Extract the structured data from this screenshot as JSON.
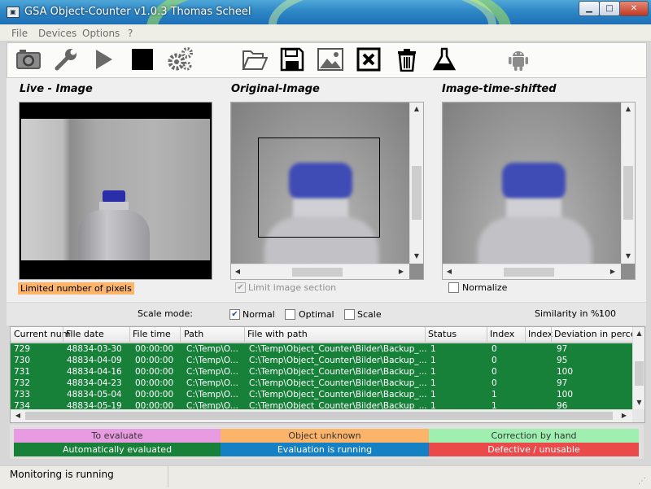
{
  "window": {
    "title": "GSA Object-Counter v1.0.3  Thomas Scheel",
    "app_icon": "camera-icon"
  },
  "menu": [
    "File",
    "Devices",
    "Options",
    "?"
  ],
  "toolbar": {
    "icons": [
      "camera-icon",
      "wrench-icon",
      "play-icon",
      "stop-icon",
      "gears-icon",
      "folder-open-icon",
      "save-icon",
      "image-icon",
      "delete-image-icon",
      "trash-icon",
      "flask-icon",
      "android-icon"
    ]
  },
  "panels": {
    "live_title": "Live - Image",
    "original_title": "Original-Image",
    "shifted_title": "Image-time-shifted",
    "limited_pixels": "Limited number of pixels",
    "limit_section": "Limit image section",
    "normalize": "Normalize"
  },
  "scale": {
    "label": "Scale mode:",
    "options": [
      {
        "label": "Normal",
        "checked": true
      },
      {
        "label": "Optimal",
        "checked": false
      },
      {
        "label": "Scale",
        "checked": false
      }
    ],
    "similarity_label": "Similarity in %:",
    "similarity_value": "100"
  },
  "table": {
    "columns": [
      "Current numl",
      "File date",
      "File time",
      "Path",
      "File with path",
      "Status",
      "Index",
      "Index",
      "Deviation in percent"
    ],
    "rows": [
      [
        "729",
        "48834-03-30",
        "00:00:00",
        "C:\\Temp\\O...",
        "C:\\Temp\\Object_Counter\\Bilder\\Backup_...",
        "1",
        "0",
        "97"
      ],
      [
        "730",
        "48834-04-09",
        "00:00:00",
        "C:\\Temp\\O...",
        "C:\\Temp\\Object_Counter\\Bilder\\Backup_...",
        "1",
        "0",
        "95"
      ],
      [
        "731",
        "48834-04-16",
        "00:00:00",
        "C:\\Temp\\O...",
        "C:\\Temp\\Object_Counter\\Bilder\\Backup_...",
        "1",
        "0",
        "100"
      ],
      [
        "732",
        "48834-04-23",
        "00:00:00",
        "C:\\Temp\\O...",
        "C:\\Temp\\Object_Counter\\Bilder\\Backup_...",
        "1",
        "0",
        "97"
      ],
      [
        "733",
        "48834-05-04",
        "00:00:00",
        "C:\\Temp\\O...",
        "C:\\Temp\\Object_Counter\\Bilder\\Backup_...",
        "1",
        "1",
        "100"
      ],
      [
        "734",
        "48834-05-19",
        "00:00:00",
        "C:\\Temp\\O...",
        "C:\\Temp\\Object_Counter\\Bilder\\Backup_...",
        "1",
        "1",
        "96"
      ]
    ]
  },
  "legend": [
    {
      "label": "To evaluate",
      "color": "#e89be0",
      "text_color": "#333333"
    },
    {
      "label": "Object unknown",
      "color": "#fcb46a",
      "text_color": "#333333"
    },
    {
      "label": "Correction by hand",
      "color": "#9ff0b0",
      "text_color": "#333333"
    },
    {
      "label": "Automatically evaluated",
      "color": "#17813a",
      "text_color": "#ffffff"
    },
    {
      "label": "Evaluation is running",
      "color": "#1680c5",
      "text_color": "#ffffff"
    },
    {
      "label": "Defective / unusable",
      "color": "#ea4a4a",
      "text_color": "#ffffff"
    }
  ],
  "status": {
    "text": "Monitoring is running"
  }
}
